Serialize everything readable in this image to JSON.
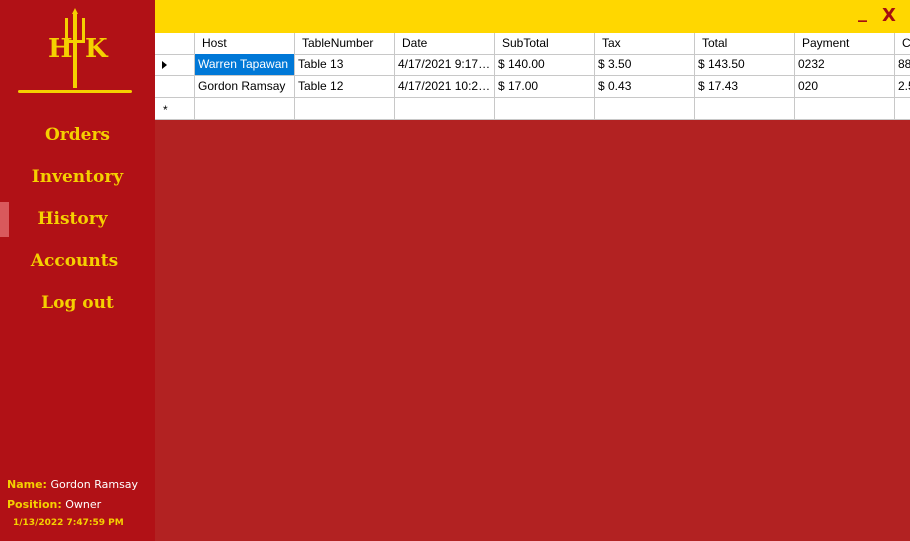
{
  "window": {
    "minimize_label": "_",
    "close_label": "X"
  },
  "logo": {
    "text_left": "H",
    "text_right": "K",
    "icon": "trident-icon"
  },
  "nav": [
    {
      "label": "Orders"
    },
    {
      "label": "Inventory"
    },
    {
      "label": "History"
    },
    {
      "label": "Accounts"
    },
    {
      "label": "Log out"
    }
  ],
  "active_nav": "History",
  "user": {
    "name_key": "Name:",
    "name": "Gordon Ramsay",
    "position_key": "Position:",
    "position": "Owner",
    "datetime": "1/13/2022 7:47:59 PM"
  },
  "table": {
    "columns": [
      "Host",
      "TableNumber",
      "Date",
      "SubTotal",
      "Tax",
      "Total",
      "Payment",
      "C"
    ],
    "rows": [
      [
        "Warren Tapawan",
        "Table 13",
        "4/17/2021 9:17:...",
        "$ 140.00",
        "$ 3.50",
        "$ 143.50",
        "0232",
        "88"
      ],
      [
        "Gordon Ramsay",
        "Table 12",
        "4/17/2021 10:23...",
        "$ 17.00",
        "$ 0.43",
        "$ 17.43",
        "020",
        "2.5"
      ]
    ],
    "new_row_marker": "*"
  },
  "colors": {
    "sidebar": "#b11116",
    "content": "#b22222",
    "accent": "#f5d000",
    "topbar": "#ffd700",
    "selection": "#0078d7"
  }
}
